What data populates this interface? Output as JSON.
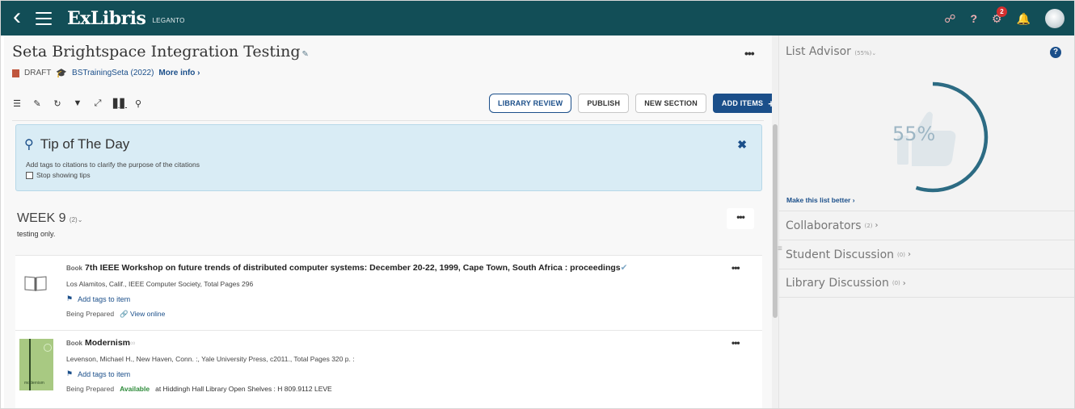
{
  "topbar": {
    "brand": "ExLibris",
    "brand_sub": "LEGANTO",
    "notification_count": "2",
    "icons": [
      "back-icon",
      "hamburger-icon",
      "link-icon",
      "help-icon",
      "gears-icon",
      "bell-icon",
      "avatar"
    ]
  },
  "list": {
    "title": "Seta Brightspace Integration Testing",
    "status": "DRAFT",
    "course": "BSTrainingSeta (2022)",
    "more_info": "More info"
  },
  "actions": {
    "library_review": "LIBRARY REVIEW",
    "publish": "PUBLISH",
    "new_section": "NEW SECTION",
    "add_items": "ADD ITEMS"
  },
  "tip": {
    "title": "Tip of The Day",
    "text": "Add tags to citations to clarify the purpose of the citations",
    "stop_label": "Stop showing tips"
  },
  "section": {
    "title": "WEEK 9",
    "count": "(2)",
    "description": "testing only."
  },
  "items": [
    {
      "type": "Book",
      "title": "7th IEEE Workshop on future trends of distributed computer systems: December 20-22, 1999, Cape Town, South Africa : proceedings",
      "subtitle": "Los Alamitos, Calif., IEEE Computer Society, Total Pages 296",
      "tags_label": "Add tags to item",
      "status": "Being Prepared",
      "link": "View online"
    },
    {
      "type": "Book",
      "title": "Modernism",
      "subtitle": "Levenson, Michael H., New Haven, Conn. :, Yale University Press, c2011., Total Pages 320 p. :",
      "tags_label": "Add tags to item",
      "status": "Being Prepared",
      "availability": "Available",
      "location": "at Hiddingh Hall Library Open Shelves : H 809.9112 LEVE",
      "cover_text": "modernism"
    }
  ],
  "advisor": {
    "title": "List Advisor",
    "percent_small": "(55%)",
    "percent": "55%",
    "progress": 0.55,
    "make_better": "Make this list better"
  },
  "side_sections": [
    {
      "label": "Collaborators",
      "count": "(2)"
    },
    {
      "label": "Student Discussion",
      "count": "(0)"
    },
    {
      "label": "Library Discussion",
      "count": "(0)"
    }
  ],
  "colors": {
    "topbar": "#124e57",
    "primary": "#1b4f8a",
    "tip_bg": "#d9ecf5",
    "available": "#2e8b3a",
    "gauge": "#2c6b83"
  }
}
